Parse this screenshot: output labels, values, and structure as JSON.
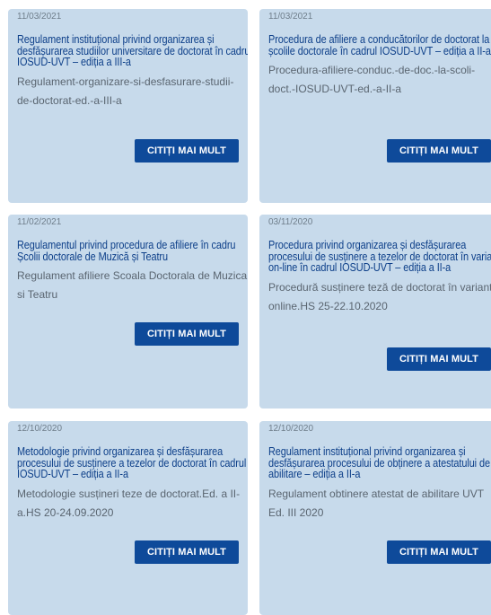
{
  "cards": [
    {
      "date": "11/03/2021",
      "title": "Regulament instituțional privind organizarea și desfășurarea studiilor universitare de doctorat în cadrul IOSUD-UVT – ediția a III-a",
      "description": "Regulament-organizare-si-desfasurare-studii-de-doctorat-ed.-a-III-a",
      "button": "CITIȚI MAI MULT"
    },
    {
      "date": "11/03/2021",
      "title": "Procedura de afiliere a conducătorilor de doctorat la școlile doctorale în cadrul IOSUD-UVT – ediția a II-a",
      "description": "Procedura-afiliere-conduc.-de-doc.-la-scoli-doct.-IOSUD-UVT-ed.-a-II-a",
      "button": "CITIȚI MAI MULT"
    },
    {
      "date": "11/02/2021",
      "title": "Regulamentul privind procedura de afiliere în cadru Școlii doctorale de Muzică și Teatru",
      "description": "Regulament afiliere Scoala Doctorala de Muzica si Teatru",
      "button": "CITIȚI MAI MULT"
    },
    {
      "date": "03/11/2020",
      "title": "Procedura privind organizarea și desfășurarea procesului de susținere a tezelor de doctorat în variantă on-line în cadrul IOSUD-UVT – ediția a II-a",
      "description": "Procedură susținere teză de doctorat în variantă online.HS 25-22.10.2020",
      "button": "CITIȚI MAI MULT"
    },
    {
      "date": "12/10/2020",
      "title": "Metodologie privind organizarea și desfășurarea procesului de susținere a tezelor de doctorat în cadrul IOSUD-UVT – ediția a II-a",
      "description": "Metodologie susțineri teze de doctorat.Ed. a II-a.HS 20-24.09.2020",
      "button": "CITIȚI MAI MULT"
    },
    {
      "date": "12/10/2020",
      "title": "Regulament instituțional privind organizarea și desfășurarea procesului de obținere a atestatului de abilitare – ediția a II-a",
      "description": "Regulament obtinere atestat de abilitare UVT Ed. III 2020",
      "button": "CITIȚI MAI MULT"
    }
  ]
}
